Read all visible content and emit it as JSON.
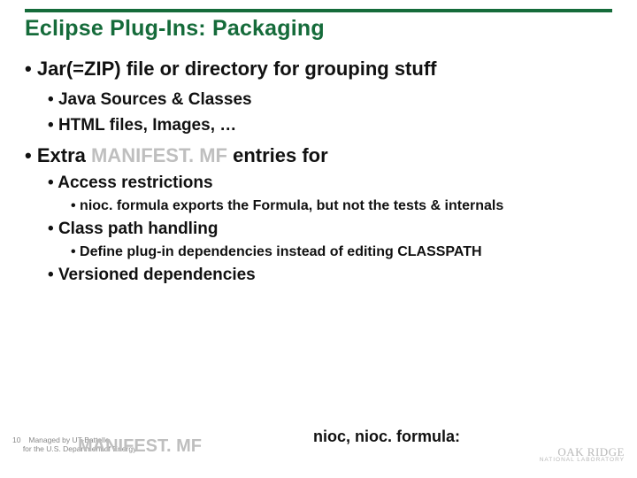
{
  "title": "Eclipse Plug-Ins: Packaging",
  "b1": {
    "text": "Jar(=ZIP) file or directory for grouping stuff"
  },
  "b1s": {
    "a": "Java Sources & Classes",
    "b": "HTML files, Images, …"
  },
  "b2": {
    "pre": "Extra ",
    "faded": "MANIFEST. MF",
    "post": " entries for"
  },
  "b2s": {
    "a": "Access restrictions",
    "a1": "nioc. formula exports the Formula, but not the tests & internals",
    "b": "Class path handling",
    "b1": "Define plug-in dependencies instead of editing CLASSPATH",
    "c": "Versioned dependencies"
  },
  "nioc": "nioc, nioc. formula:",
  "mf": "MANIFEST. MF",
  "footer": {
    "num": "10",
    "line1": "Managed by UT-Battelle",
    "line2": "for the U.S. Department of Energy"
  },
  "logo": {
    "brand": "OAK RIDGE",
    "lab": "NATIONAL LABORATORY"
  }
}
